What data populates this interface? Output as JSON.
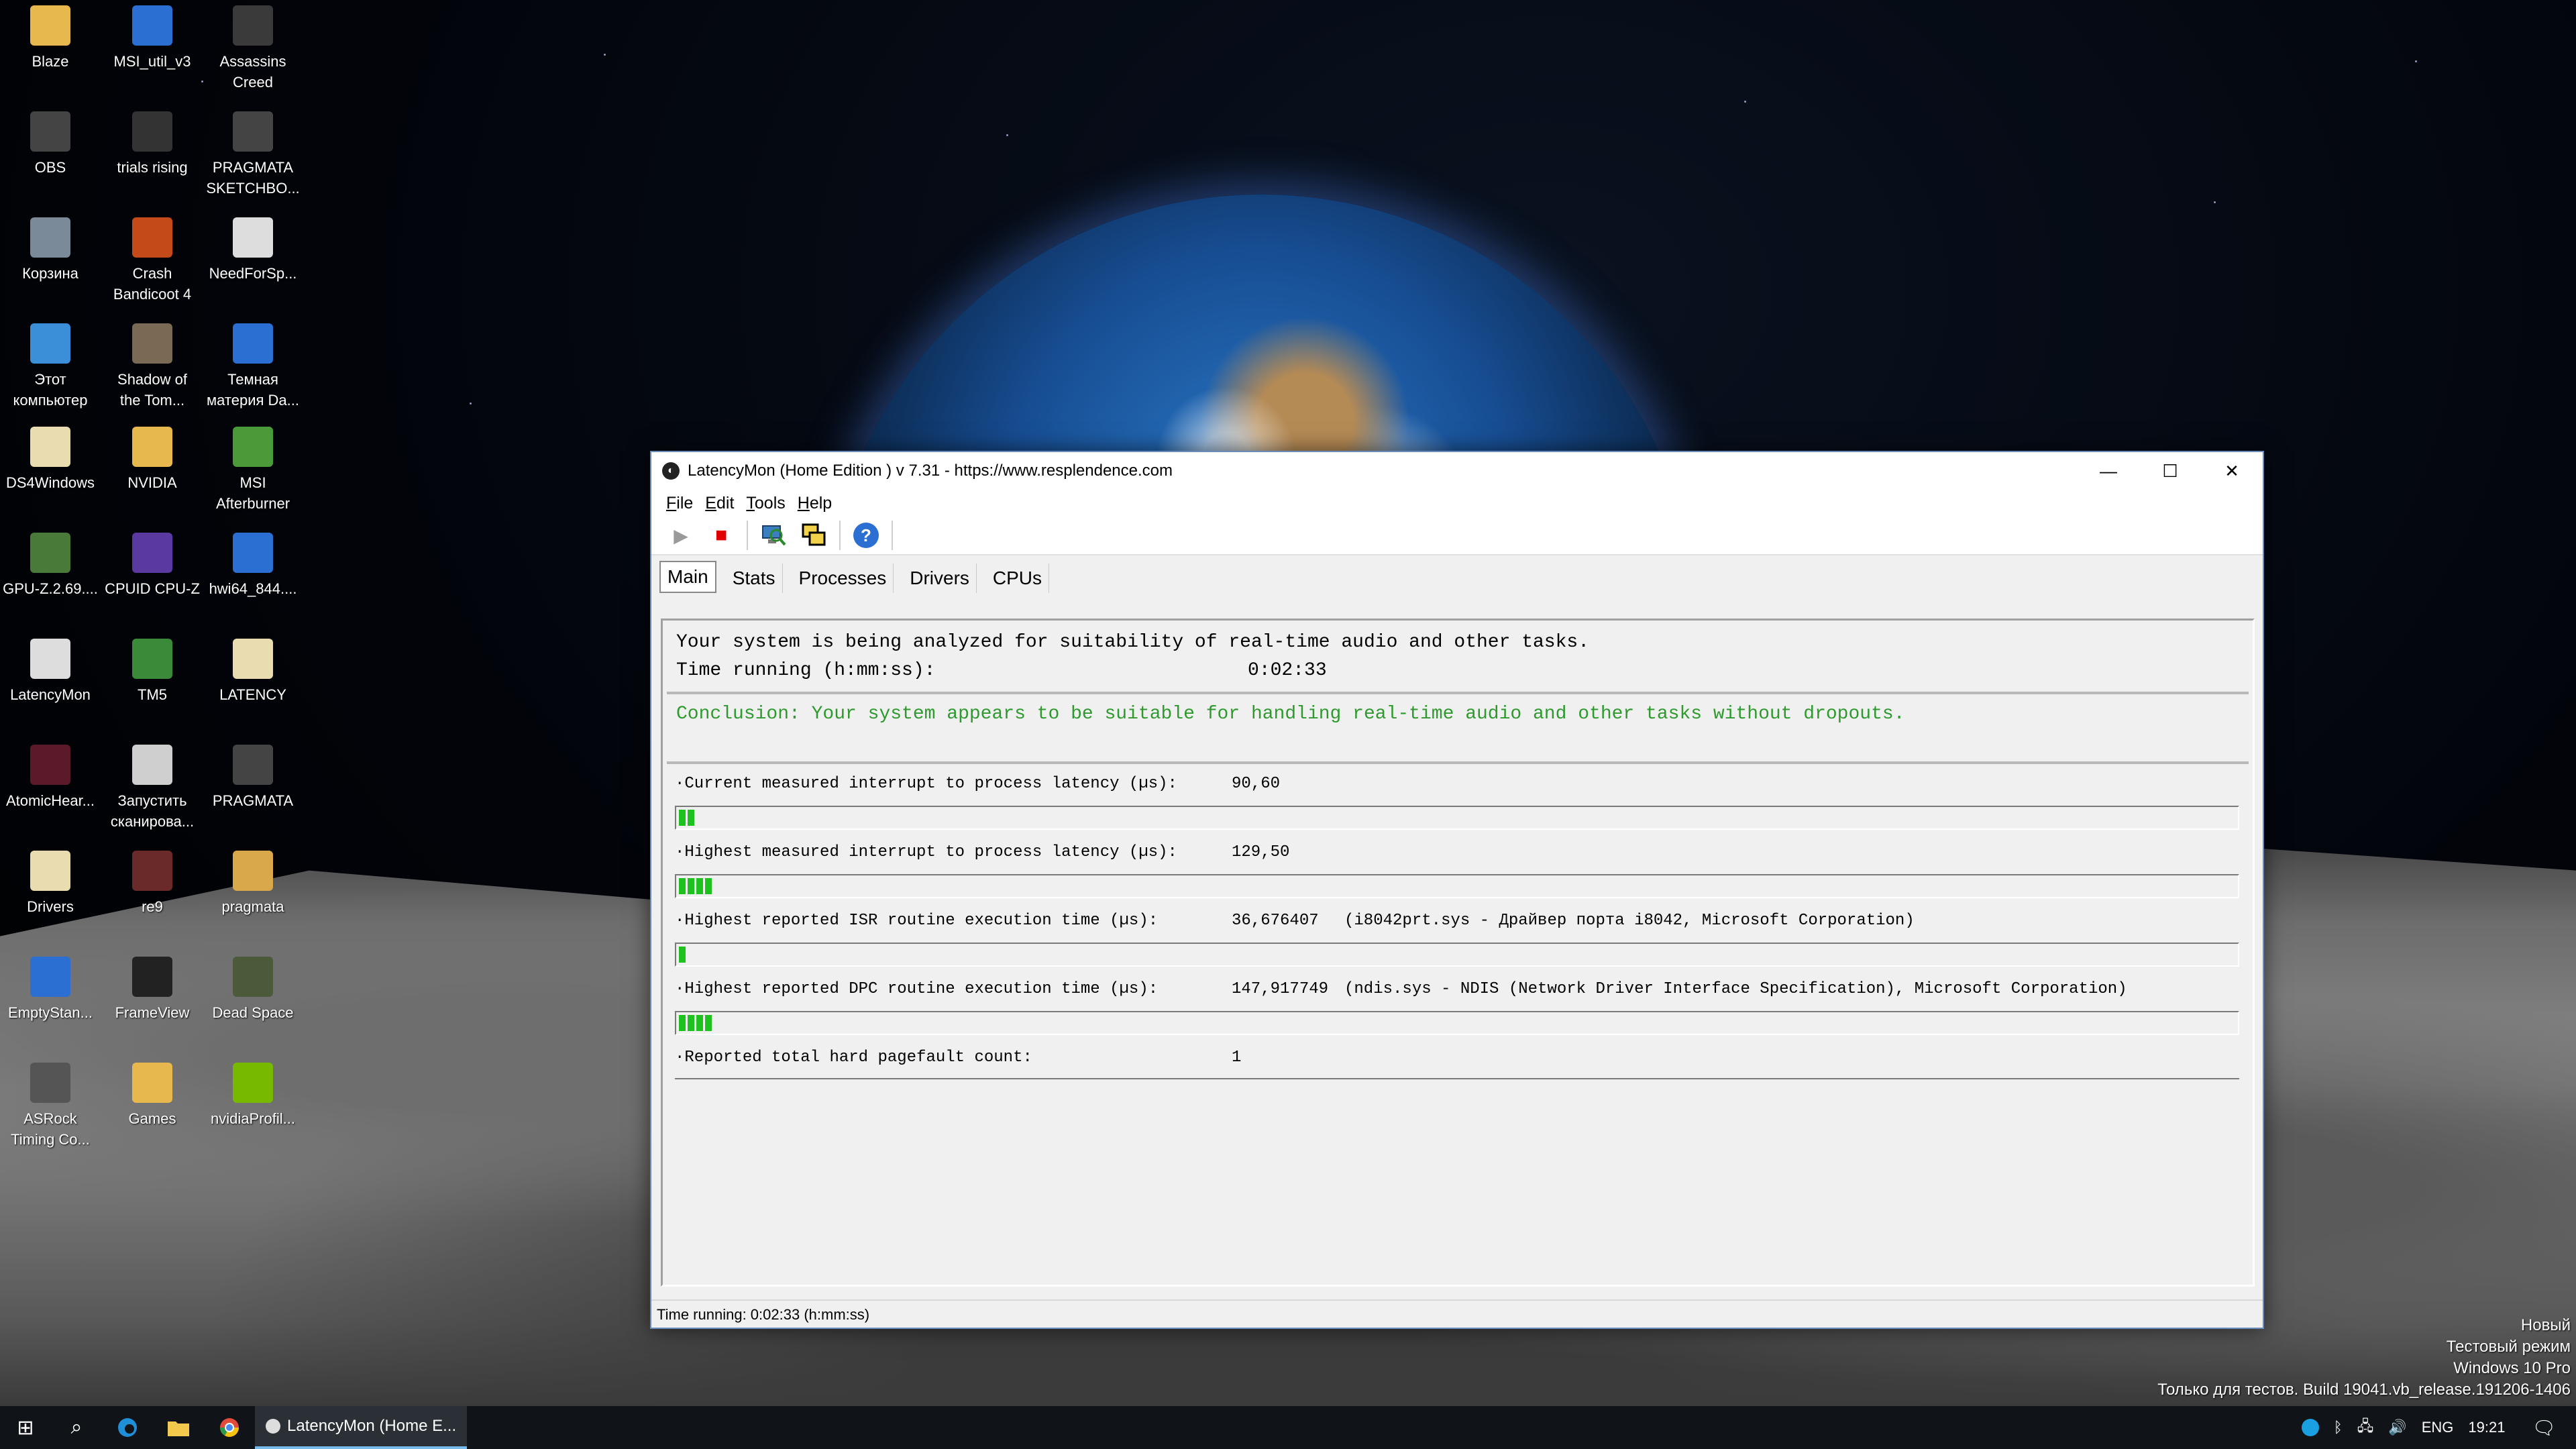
{
  "desktop": {
    "icons": [
      {
        "label": "Blaze",
        "icon": "folder-icon",
        "color": "#e6b84d"
      },
      {
        "label": "MSI_util_v3",
        "icon": "window-icon",
        "color": "#2a6fd1"
      },
      {
        "label": "Assassins\nCreed",
        "icon": "assassin-icon",
        "color": "#3a3a3a"
      },
      {
        "label": "OBS",
        "icon": "obs-icon",
        "color": "#444"
      },
      {
        "label": "trials rising",
        "icon": "game-icon",
        "color": "#333"
      },
      {
        "label": "PRAGMATA\nSKETCHBO...",
        "icon": "game-icon",
        "color": "#444"
      },
      {
        "label": "Корзина",
        "icon": "recycle-bin-icon",
        "color": "#7b8a99"
      },
      {
        "label": "Crash\nBandicoot 4",
        "icon": "game-icon",
        "color": "#c54a1a"
      },
      {
        "label": "NeedForSp...",
        "icon": "document-icon",
        "color": "#ddd"
      },
      {
        "label": "Этот\nкомпьютер",
        "icon": "computer-icon",
        "color": "#3a8fd8"
      },
      {
        "label": "Shadow of\nthe Tom...",
        "icon": "game-icon",
        "color": "#7a6a55"
      },
      {
        "label": "Темная\nматерия Da...",
        "icon": "document-icon",
        "color": "#2a6fd1"
      },
      {
        "label": "DS4Windows",
        "icon": "document-icon",
        "color": "#e8dcb0"
      },
      {
        "label": "NVIDIA",
        "icon": "folder-icon",
        "color": "#e6b84d"
      },
      {
        "label": "MSI\nAfterburner",
        "icon": "afterburner-icon",
        "color": "#4a9a3a"
      },
      {
        "label": "GPU-Z.2.69....",
        "icon": "gpu-icon",
        "color": "#4a7a3a"
      },
      {
        "label": "CPUID CPU-Z",
        "icon": "cpu-icon",
        "color": "#5a3aa0"
      },
      {
        "label": "hwi64_844....",
        "icon": "hwinfo-icon",
        "color": "#2a6fd1"
      },
      {
        "label": "LatencyMon",
        "icon": "latencymon-icon",
        "color": "#ddd"
      },
      {
        "label": "TM5",
        "icon": "ram-icon",
        "color": "#3a8a3a"
      },
      {
        "label": "LATENCY",
        "icon": "document-icon",
        "color": "#e8dcb0"
      },
      {
        "label": "AtomicHear...",
        "icon": "game-icon",
        "color": "#5a1a2a"
      },
      {
        "label": "Запустить\nсканирова...",
        "icon": "scanner-icon",
        "color": "#cfcfcf"
      },
      {
        "label": "PRAGMATA",
        "icon": "game-icon",
        "color": "#444"
      },
      {
        "label": "Drivers",
        "icon": "document-icon",
        "color": "#e8dcb0"
      },
      {
        "label": "re9",
        "icon": "game-icon",
        "color": "#6a2a2a"
      },
      {
        "label": "pragmata",
        "icon": "folder-icon",
        "color": "#d8a84a"
      },
      {
        "label": "EmptyStan...",
        "icon": "window-icon",
        "color": "#2a6fd1"
      },
      {
        "label": "FrameView",
        "icon": "frameview-icon",
        "color": "#222"
      },
      {
        "label": "Dead Space",
        "icon": "game-icon",
        "color": "#4a5a3a"
      },
      {
        "label": "ASRock\nTiming Co...",
        "icon": "asrock-icon",
        "color": "#555"
      },
      {
        "label": "Games",
        "icon": "folder-icon",
        "color": "#e6b84d"
      },
      {
        "label": "nvidiaProfil...",
        "icon": "nvidia-icon",
        "color": "#76b900"
      }
    ]
  },
  "window": {
    "title": "LatencyMon  (Home Edition )  v 7.31 - https://www.resplendence.com",
    "controls": {
      "minimize": "—",
      "maximize": "☐",
      "close": "✕"
    },
    "menu": [
      "File",
      "Edit",
      "Tools",
      "Help"
    ],
    "toolbar": {
      "play": "▶",
      "stop": "■",
      "help": "?",
      "colors": {
        "play": "#9a9a9a",
        "stop": "#e00000",
        "help": "#2a6fd1"
      }
    },
    "tabs": [
      {
        "label": "Main",
        "active": true
      },
      {
        "label": "Stats",
        "active": false
      },
      {
        "label": "Processes",
        "active": false
      },
      {
        "label": "Drivers",
        "active": false
      },
      {
        "label": "CPUs",
        "active": false
      }
    ],
    "summary": {
      "line1": "Your system is being analyzed for suitability of real-time audio and other tasks.",
      "time_label": "Time running (h:mm:ss):",
      "time_value": "0:02:33"
    },
    "conclusion": "Conclusion: Your system appears to be suitable for handling real-time audio and other tasks without dropouts.",
    "conclusion_color": "#2e9a2e",
    "metrics": [
      {
        "label": "·Current measured interrupt to process latency (µs):",
        "value": "90,60",
        "extra": "",
        "bar_segments": 2
      },
      {
        "label": "·Highest measured interrupt to process latency (µs):",
        "value": "129,50",
        "extra": "",
        "bar_segments": 4
      },
      {
        "label": "·Highest reported ISR routine execution time (µs):",
        "value": "36,676407",
        "extra": "(i8042prt.sys - Драйвер порта i8042, Microsoft Corporation)",
        "bar_segments": 1
      },
      {
        "label": "·Highest reported DPC routine execution time (µs):",
        "value": "147,917749",
        "extra": "(ndis.sys - NDIS (Network Driver Interface Specification), Microsoft Corporation)",
        "bar_segments": 4
      },
      {
        "label": "·Reported total hard pagefault count:",
        "value": "1",
        "extra": "",
        "bar_segments": 0
      }
    ],
    "bar_color": "#1ec21e",
    "status": "Time running: 0:02:33  (h:mm:ss)"
  },
  "taskbar": {
    "start": "⊞",
    "search": "⌕",
    "active_app": "LatencyMon  (Home E...",
    "tray": {
      "language": "ENG",
      "time": "19:21"
    }
  },
  "watermark": {
    "line1": "Новый",
    "line2": "Тестовый режим",
    "line3": "Windows 10 Pro",
    "line4": "Только для тестов. Build 19041.vb_release.191206-1406"
  }
}
